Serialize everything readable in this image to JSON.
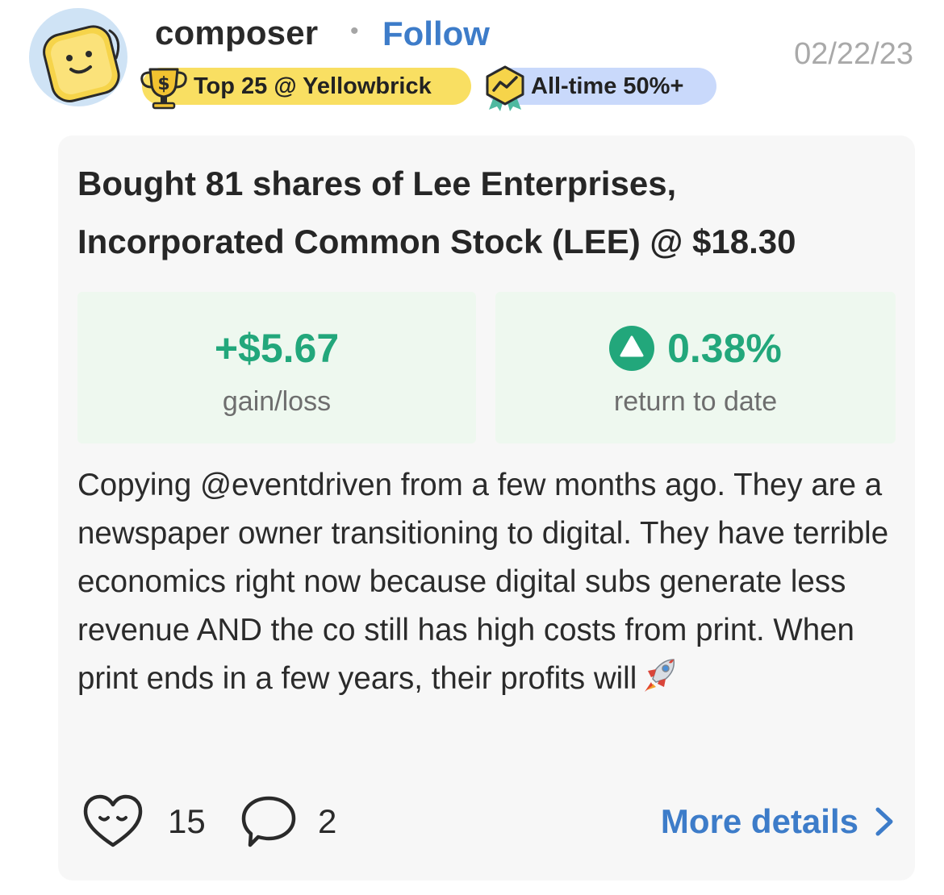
{
  "post": {
    "username": "composer",
    "separator": "•",
    "follow_label": "Follow",
    "date": "02/22/23",
    "avatar_icon": "smiley-square-icon",
    "badges": [
      {
        "label": "Top 25 @ Yellowbrick",
        "icon": "trophy-dollar-icon",
        "color": "#f9df62"
      },
      {
        "label": "All-time 50%+",
        "icon": "chart-ribbon-icon",
        "color": "#c9d9fb"
      }
    ],
    "headline": "Bought 81 shares of Lee Enterprises, Incorporated Common Stock (LEE) @ $18.30",
    "stats": {
      "gain_value": "+$5.67",
      "gain_label": "gain/loss",
      "return_value": "0.38%",
      "return_label": "return to date",
      "positive_color": "#22a77b"
    },
    "body": "Copying @eventdriven from a few months ago. They are a newspaper owner transitioning to digital. They have terrible economics right now because digital subs generate less revenue AND the co still has high costs from print. When print ends in a few years, their profits will",
    "body_emoji_icon": "rocket-icon",
    "likes": "15",
    "comments": "2",
    "more_details_label": "More details",
    "accent_color": "#3d7cc9"
  }
}
